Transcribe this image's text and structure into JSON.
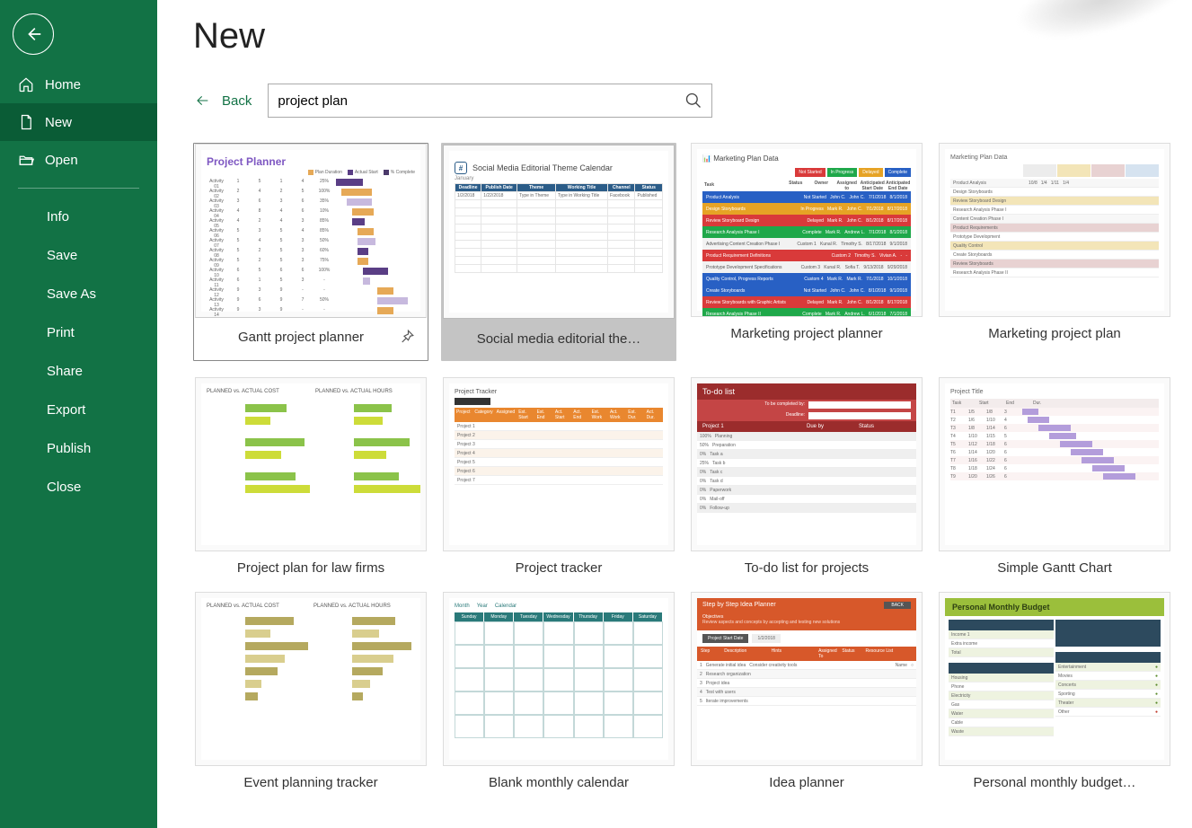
{
  "sidebar": {
    "home": "Home",
    "new": "New",
    "open": "Open",
    "info": "Info",
    "save": "Save",
    "saveas": "Save As",
    "print": "Print",
    "share": "Share",
    "export": "Export",
    "publish": "Publish",
    "close": "Close"
  },
  "page": {
    "title": "New",
    "back": "Back"
  },
  "search": {
    "value": "project plan"
  },
  "templates": [
    {
      "label": "Gantt project planner",
      "state": "selected"
    },
    {
      "label": "Social media editorial the…",
      "state": "hovered"
    },
    {
      "label": "Marketing project planner",
      "state": "normal"
    },
    {
      "label": "Marketing project plan",
      "state": "normal"
    },
    {
      "label": "Project plan for law firms",
      "state": "normal"
    },
    {
      "label": "Project tracker",
      "state": "normal"
    },
    {
      "label": "To-do list for projects",
      "state": "normal"
    },
    {
      "label": "Simple Gantt Chart",
      "state": "normal"
    },
    {
      "label": "Event planning tracker",
      "state": "normal"
    },
    {
      "label": "Blank monthly calendar",
      "state": "normal"
    },
    {
      "label": "Idea planner",
      "state": "normal"
    },
    {
      "label": "Personal monthly budget…",
      "state": "normal"
    }
  ],
  "thumb_text": {
    "gantt_title": "Project Planner",
    "social_title": "Social Media Editorial Theme Calendar",
    "mkt_data_title": "Marketing Plan Data",
    "mkt_plan_title": "Marketing Plan Data",
    "todo_title": "To-do list",
    "simple_gantt_title": "Project Title",
    "planned_cost": "PLANNED vs. ACTUAL COST",
    "planned_hours": "PLANNED vs. ACTUAL HOURS",
    "idea_title": "Step by Step Idea Planner",
    "budget_title": "Personal Monthly Budget",
    "proj_tracker": "Project Tracker",
    "cal_month": "Month",
    "cal_year": "Year",
    "cal_view": "Calendar"
  }
}
